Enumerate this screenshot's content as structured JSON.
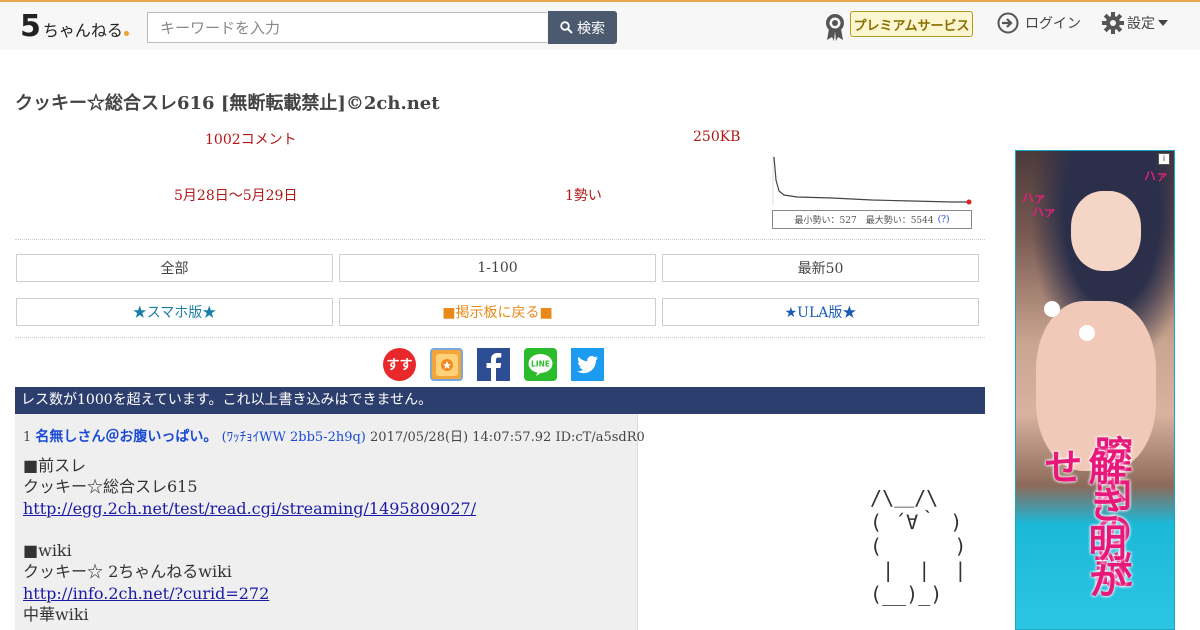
{
  "header": {
    "logo_text": "5ちゃんねる",
    "search_placeholder": "キーワードを入力",
    "search_button": "検索",
    "premium_label": "プレミアムサービス",
    "login_label": "ログイン",
    "settings_label": "設定"
  },
  "thread": {
    "title": "クッキー☆総合スレ616 [無断転載禁止]©2ch.net",
    "comments": "1002コメント",
    "size": "250KB",
    "date_range": "5月28日〜5月29日",
    "momentum": "1勢い",
    "graph_caption": "最小勢い：527　最大勢い：5544",
    "graph_help": "(?)"
  },
  "nav": {
    "all": "全部",
    "range": "1-100",
    "latest": "最新50",
    "smartphone": "★スマホ版★",
    "back_board": "■掲示板に戻る■",
    "ula": "★ULA版★"
  },
  "share_icons": [
    "susu-icon",
    "bookmark-icon",
    "facebook-icon",
    "line-icon",
    "twitter-icon"
  ],
  "banner": "レス数が1000を超えています。これ以上書き込みはできません。",
  "post": {
    "number": "1",
    "name": "名無しさん＠お腹いっぱい。",
    "trip": "(ﾜｯﾁｮｲWW 2bb5-2h9q)",
    "date": "2017/05/28(日) 14:07:57.92",
    "id": "ID:cT/a5sdR0",
    "lines": [
      {
        "text": "■前スレ",
        "link": false
      },
      {
        "text": "クッキー☆総合スレ615",
        "link": false
      },
      {
        "text": "http://egg.2ch.net/test/read.cgi/streaming/1495809027/",
        "link": true
      },
      {
        "text": "",
        "link": false
      },
      {
        "text": "■wiki",
        "link": false
      },
      {
        "text": "クッキー☆ 2ちゃんねるwiki",
        "link": false
      },
      {
        "text": "http://info.2ch.net/?curid=272",
        "link": true
      },
      {
        "text": "中華wiki",
        "link": false
      }
    ]
  },
  "ascii_art": " /\\＿/\\\n ( ´∀｀ )\n (      )\n  |  |  |\n (__)_)",
  "ad": {
    "headline": "膣内の謎",
    "sub": "解き明かせ",
    "ha1": "ハァ",
    "ha2": "ハァ",
    "ha3": "ハァ"
  },
  "colors": {
    "stat_red": "#b01818",
    "banner_bg": "#2c3e6e",
    "link_blue": "#1a1aa6",
    "accent_orange": "#e6a84b"
  }
}
